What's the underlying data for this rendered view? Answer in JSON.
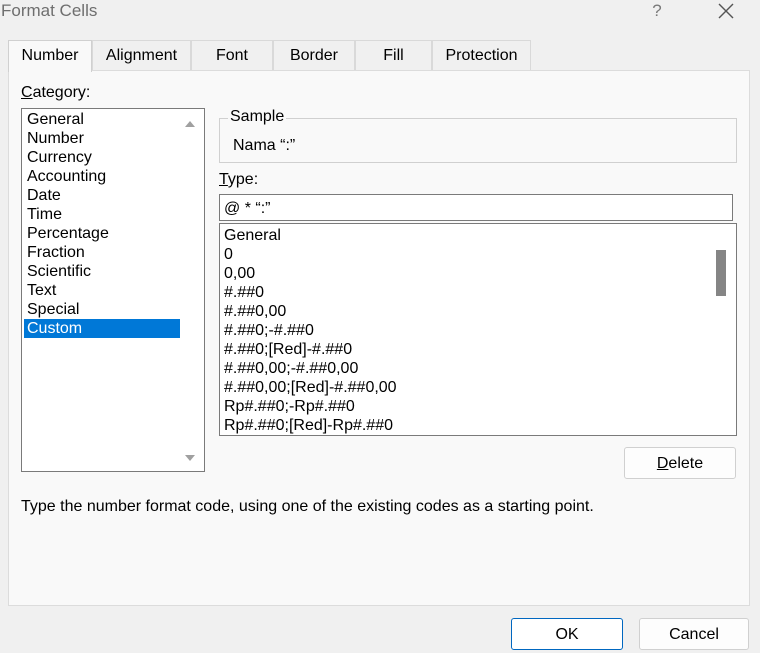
{
  "window": {
    "title": "Format Cells",
    "help": "?",
    "close_icon": "close-icon"
  },
  "tabs": [
    {
      "label": "Number",
      "active": true
    },
    {
      "label": "Alignment"
    },
    {
      "label": "Font"
    },
    {
      "label": "Border"
    },
    {
      "label": "Fill"
    },
    {
      "label": "Protection"
    }
  ],
  "category": {
    "label_first": "C",
    "label_rest": "ategory:",
    "items": [
      "General",
      "Number",
      "Currency",
      "Accounting",
      "Date",
      "Time",
      "Percentage",
      "Fraction",
      "Scientific",
      "Text",
      "Special",
      "Custom"
    ],
    "selected": "Custom"
  },
  "sample": {
    "legend": "Sample",
    "value": "Nama “:”"
  },
  "type": {
    "label_first": "T",
    "label_rest": "ype:",
    "value": "@ * “:”",
    "formats": [
      "General",
      "0",
      "0,00",
      "#.##0",
      "#.##0,00",
      "#.##0;-#.##0",
      "#.##0;[Red]-#.##0",
      "#.##0,00;-#.##0,00",
      "#.##0,00;[Red]-#.##0,00",
      "Rp#.##0;-Rp#.##0",
      "Rp#.##0;[Red]-Rp#.##0"
    ]
  },
  "buttons": {
    "delete_first": "D",
    "delete_rest": "elete",
    "ok": "OK",
    "cancel": "Cancel"
  },
  "description": "Type the number format code, using one of the existing codes as a starting point.",
  "colors": {
    "selection": "#0078d7",
    "ok_border": "#0067c0"
  }
}
